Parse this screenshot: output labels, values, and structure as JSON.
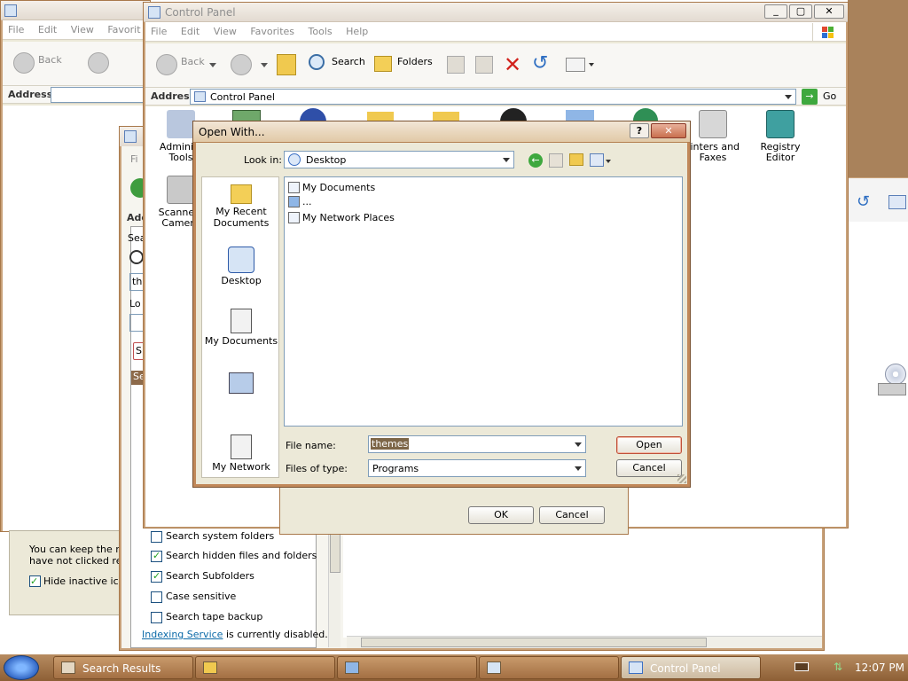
{
  "control_panel": {
    "title": "Control Panel",
    "menu": [
      "File",
      "Edit",
      "View",
      "Favorites",
      "Tools",
      "Help"
    ],
    "toolbar": {
      "back": "Back",
      "search": "Search",
      "folders": "Folders"
    },
    "address_label": "Address",
    "address_value": "Control Panel",
    "go_label": "Go",
    "items": {
      "admin": "Administ\nTools",
      "printers": "rinters and\nFaxes",
      "registry": "Registry\nEditor",
      "scanners": "Scanners\nCamera"
    }
  },
  "background_window": {
    "menu": [
      "File",
      "Edit",
      "View",
      "Favorit"
    ],
    "back": "Back",
    "address_label": "Address"
  },
  "notification_text": {
    "line1": "You can keep the no",
    "line2": "have not clicked rece",
    "hide_inactive": "Hide inactive icon"
  },
  "search_panel": {
    "options": [
      {
        "label": "Search system folders",
        "checked": false
      },
      {
        "label": "Search hidden files and folders",
        "checked": true
      },
      {
        "label": "Search Subfolders",
        "checked": true
      },
      {
        "label": "Case sensitive",
        "checked": false
      },
      {
        "label": "Search tape backup",
        "checked": false
      }
    ],
    "indexing_link": "Indexing Service",
    "indexing_suffix": " is currently disabled.",
    "fragments": {
      "fi": "Fi",
      "add": "Add",
      "sea": "Sea",
      "th": "th",
      "lo": "Lo",
      "s": "S",
      "se": "Se"
    }
  },
  "open_with": {
    "title": "Open With...",
    "look_in_label": "Look in:",
    "look_in_value": "Desktop",
    "places": [
      "My Recent\nDocuments",
      "Desktop",
      "My Documents",
      "",
      "My Network"
    ],
    "files": [
      "My Documents",
      "...",
      "My Network Places"
    ],
    "file_name_label": "File name:",
    "file_name_value": "themes",
    "files_of_type_label": "Files of type:",
    "files_of_type_value": "Programs",
    "open_button": "Open",
    "cancel_button": "Cancel"
  },
  "behind_dialog": {
    "ok": "OK",
    "cancel": "Cancel"
  },
  "taskbar": {
    "tasks": [
      {
        "label": "Search Results",
        "active": false
      },
      {
        "label": "",
        "active": false
      },
      {
        "label": "",
        "active": false
      },
      {
        "label": "",
        "active": false
      },
      {
        "label": "Control Panel",
        "active": true
      }
    ],
    "clock": "12:07 PM"
  },
  "colors": {
    "accent": "#c18859",
    "taskbar": "#9b6a3f",
    "link": "#0b6aa8"
  }
}
